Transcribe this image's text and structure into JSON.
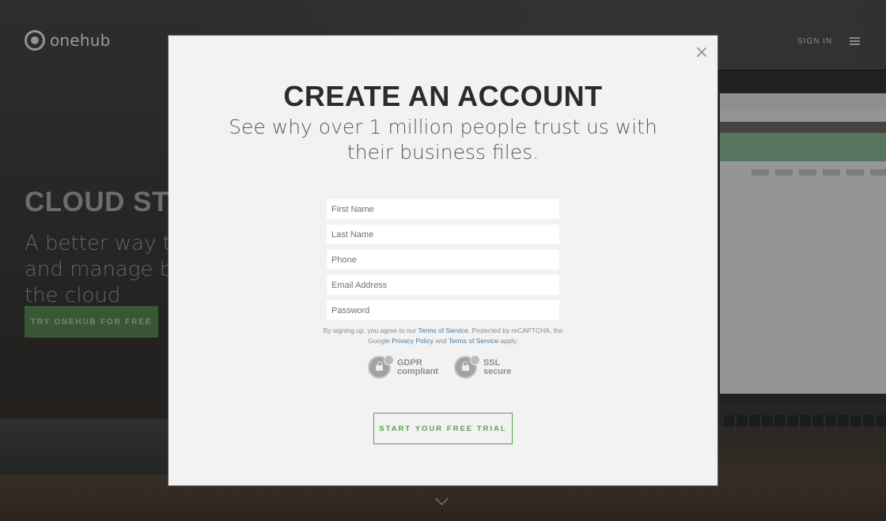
{
  "header": {
    "logo_text": "onehub",
    "signin_label": "SIGN IN"
  },
  "hero": {
    "title": "CLOUD STORAGE REDEFINED",
    "subtitle": "A better way to store, share and manage business files in the cloud",
    "cta_label": "TRY ONEHUB FOR FREE"
  },
  "modal": {
    "title": "CREATE AN ACCOUNT",
    "subtitle": "See why over 1 million people trust us with their business files.",
    "fields": {
      "first_name": "First Name",
      "last_name": "Last Name",
      "phone": "Phone",
      "email": "Email Address",
      "password": "Password"
    },
    "legal": {
      "part1": "By signing up, you agree to our ",
      "tos1": "Terms of Service",
      "part2": ". Protected by reCAPTCHA, the Google ",
      "privacy": "Privacy Policy",
      "part3": " and ",
      "tos2": "Terms of Service",
      "part4": " apply."
    },
    "badges": {
      "gdpr_line1": "GDPR",
      "gdpr_line2": "compliant",
      "ssl_line1": "SSL",
      "ssl_line2": "secure"
    },
    "submit_label": "START YOUR FREE TRIAL"
  },
  "icons": {
    "close": "close-icon",
    "menu": "hamburger-menu-icon",
    "scroll": "chevron-down-icon",
    "badge": "lock-shield-icon"
  },
  "colors": {
    "accent_green": "#5e9e57",
    "link_blue": "#4a7aa8",
    "modal_bg": "#f1f2f1"
  }
}
